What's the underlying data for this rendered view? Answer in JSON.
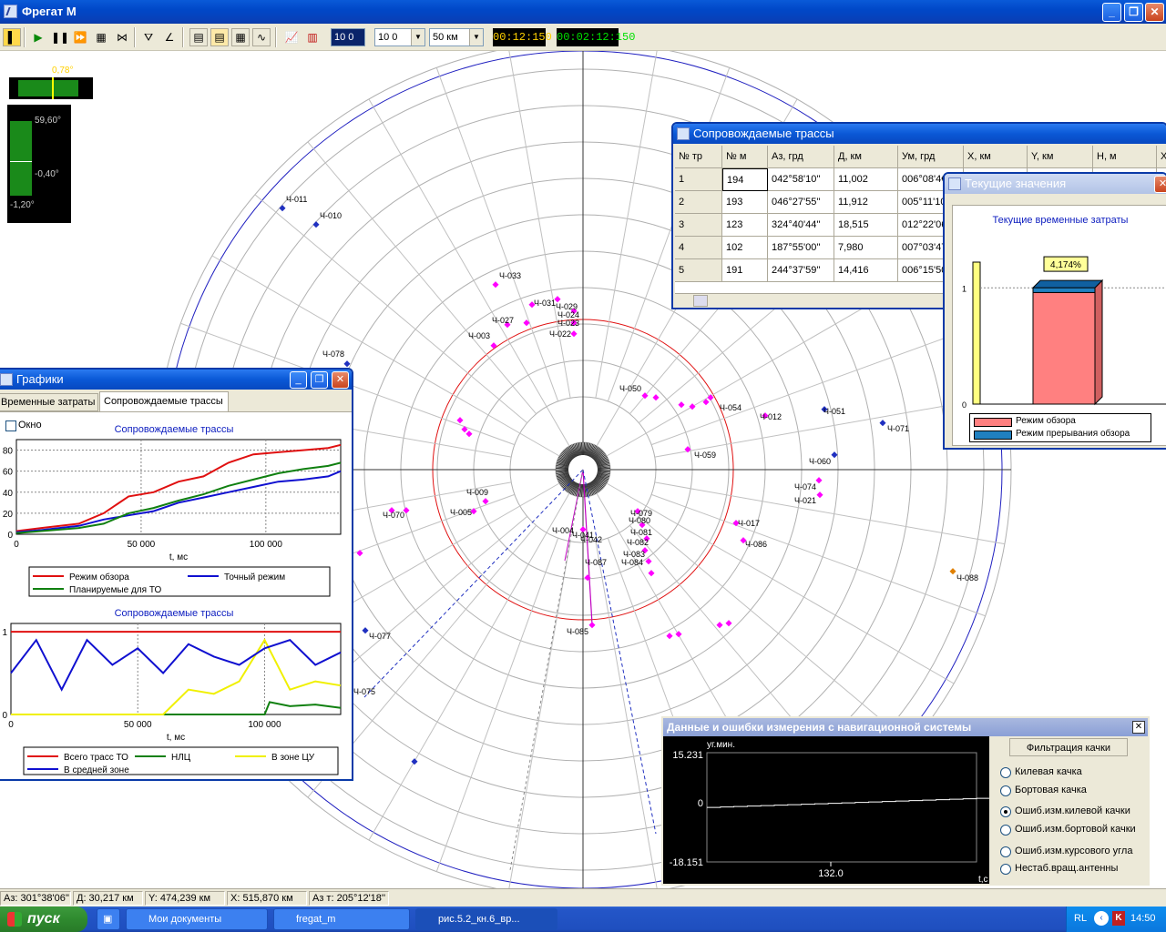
{
  "app": {
    "title": "Фрегат М"
  },
  "toolbar": {
    "field1": "10 0",
    "field2": "10 0",
    "range": "50 км",
    "time1": "00:12:150",
    "time2": "00:02:12:150"
  },
  "indicators": {
    "top_value": "0,78°",
    "top_level_fraction": 0.72,
    "v_top": "59,60°",
    "v_mid": "-0,40°",
    "v_bottom": "-1,20°"
  },
  "radar": {
    "targets": [
      "Ч-011",
      "Ч-010",
      "Ч-033",
      "Ч-031",
      "Ч-029",
      "Ч-024",
      "Ч-023",
      "Ч-022",
      "Ч-027",
      "Ч-003",
      "Ч-078",
      "Ч-059",
      "Ч-060",
      "Ч-071",
      "Ч-074",
      "Ч-021",
      "Ч-054",
      "Ч-012",
      "Ч-051",
      "Ч-009",
      "Ч-005",
      "Ч-070",
      "Ч-079",
      "Ч-080",
      "Ч-081",
      "Ч-082",
      "Ч-083",
      "Ч-084",
      "Ч-086",
      "Ч-087",
      "Ч-085",
      "Ч-088",
      "Ч-077",
      "Ч-075",
      "Ч-004",
      "Ч-042",
      "Ч-041",
      "Ч-017",
      "Ч-050"
    ]
  },
  "tracks_window": {
    "title": "Сопровождаемые трассы",
    "columns": [
      "№ тр",
      "№ м",
      "Аз, грд",
      "Д, км",
      "Ум, грд",
      "X, км",
      "Y, км",
      "H, м",
      "X"
    ],
    "rows": [
      [
        "1",
        "194",
        "042°58'10''",
        "11,002",
        "006°08'4€"
      ],
      [
        "2",
        "193",
        "046°27'55''",
        "11,912",
        "005°11'10"
      ],
      [
        "3",
        "123",
        "324°40'44''",
        "18,515",
        "012°22'06"
      ],
      [
        "4",
        "102",
        "187°55'00''",
        "7,980",
        "007°03'47"
      ],
      [
        "5",
        "191",
        "244°37'59''",
        "14,416",
        "006°15'50"
      ]
    ]
  },
  "current_window": {
    "title": "Текущие значения",
    "chart_title": "Текущие временные затраты",
    "bar_label": "4,174%",
    "legend": [
      "Режим обзора",
      "Режим прерывания обзора"
    ],
    "tick_1": "1",
    "tick_0": "0"
  },
  "graphs_window": {
    "title": "Графики",
    "tabs": [
      "Временные затраты",
      "Сопровождаемые трассы"
    ],
    "checkbox_label": "Окно"
  },
  "nav_window": {
    "title": "Данные и ошибки измерения с навигационной системы",
    "ylabel": "уг.мин.",
    "y_top": "15.231",
    "y_zero": "0",
    "y_bottom": "-18.151",
    "x_tick": "132.0",
    "x_unit": "t,c",
    "filter_button": "Фильтрация качки",
    "options": [
      "Килевая качка",
      "Бортовая качка",
      "Ошиб.изм.килевой качки",
      "Ошиб.изм.бортовой качки",
      "Ошиб.изм.курсового угла",
      "Нестаб.вращ.антенны"
    ],
    "selected_option": "Ошиб.изм.килевой качки"
  },
  "status": {
    "az": "Аз: 301°38'06''",
    "d": "Д: 30,217 км",
    "y": "Y: 474,239 км",
    "x": "X: 515,870 км",
    "azt": "Аз т: 205°12'18''"
  },
  "taskbar": {
    "start": "пуск",
    "items": [
      "Мои документы",
      "fregat_m",
      "рис.5.2_кн.6_вр..."
    ],
    "lang": "RL",
    "clock": "14:50"
  },
  "chart_data": [
    {
      "type": "line",
      "title": "Сопровождаемые трассы",
      "xlabel": "t, мс",
      "xlim": [
        0,
        130000
      ],
      "ylim": [
        0,
        90
      ],
      "x_ticks": [
        "0",
        "50 000",
        "100 000"
      ],
      "y_ticks": [
        "0",
        "20",
        "40",
        "60",
        "80"
      ],
      "series": [
        {
          "name": "Режим обзора",
          "color": "#e01010",
          "x": [
            0,
            10000,
            25000,
            35000,
            45000,
            55000,
            65000,
            75000,
            85000,
            95000,
            105000,
            115000,
            125000,
            130000
          ],
          "y": [
            3,
            6,
            10,
            20,
            36,
            40,
            50,
            55,
            68,
            76,
            78,
            80,
            82,
            85
          ]
        },
        {
          "name": "Точный режим",
          "color": "#1010d0",
          "x": [
            0,
            10000,
            25000,
            35000,
            45000,
            55000,
            65000,
            75000,
            85000,
            95000,
            105000,
            115000,
            125000,
            130000
          ],
          "y": [
            2,
            4,
            8,
            14,
            18,
            22,
            30,
            35,
            40,
            45,
            50,
            52,
            55,
            60
          ]
        },
        {
          "name": "Планируемые для ТО",
          "color": "#108010",
          "x": [
            0,
            10000,
            25000,
            35000,
            45000,
            55000,
            65000,
            75000,
            85000,
            95000,
            105000,
            115000,
            125000,
            130000
          ],
          "y": [
            1,
            3,
            6,
            10,
            20,
            25,
            32,
            38,
            46,
            52,
            58,
            62,
            65,
            68
          ]
        }
      ],
      "legend": "bottom"
    },
    {
      "type": "line",
      "title": "Сопровождаемые трассы",
      "xlabel": "t, мс",
      "xlim": [
        0,
        130000
      ],
      "ylim": [
        0,
        1.1
      ],
      "x_ticks": [
        "0",
        "50 000",
        "100 000"
      ],
      "y_ticks": [
        "0",
        "1"
      ],
      "series": [
        {
          "name": "Всего трасс ТО",
          "color": "#e01010",
          "x": [
            0,
            130000
          ],
          "y": [
            1,
            1
          ]
        },
        {
          "name": "НЛЦ",
          "color": "#108010",
          "x": [
            0,
            100000,
            102000,
            110000,
            120000,
            130000
          ],
          "y": [
            0,
            0,
            0.15,
            0.1,
            0.12,
            0.08
          ]
        },
        {
          "name": "В зоне ЦУ",
          "color": "#f0f000",
          "x": [
            0,
            60000,
            70000,
            80000,
            90000,
            100000,
            110000,
            120000,
            130000
          ],
          "y": [
            0,
            0,
            0.3,
            0.25,
            0.4,
            0.9,
            0.3,
            0.4,
            0.35
          ]
        },
        {
          "name": "В средней зоне",
          "color": "#1010d0",
          "x": [
            0,
            10000,
            20000,
            30000,
            40000,
            50000,
            60000,
            70000,
            80000,
            90000,
            100000,
            110000,
            120000,
            130000
          ],
          "y": [
            0.5,
            0.9,
            0.3,
            0.9,
            0.6,
            0.8,
            0.5,
            0.85,
            0.7,
            0.6,
            0.8,
            0.9,
            0.6,
            0.75
          ]
        }
      ],
      "legend": "bottom"
    },
    {
      "type": "bar",
      "title": "Текущие временные затраты",
      "categories": [
        ""
      ],
      "series": [
        {
          "name": "Режим обзора",
          "values": [
            0.96
          ]
        },
        {
          "name": "Режим прерывания обзора",
          "values": [
            0.04174
          ]
        }
      ],
      "ylim": [
        0,
        1.3
      ]
    },
    {
      "type": "line",
      "ylabel": "уг.мин.",
      "xlabel": "t,c",
      "ylim": [
        -18.151,
        15.231
      ],
      "x": [
        0,
        132
      ],
      "y": [
        -1.5,
        1.3
      ]
    }
  ],
  "colors": {
    "accent": "#0a3aa8",
    "radar_ring": "#e01010",
    "radar_outer": "#2020c0",
    "target": "#ff00ff"
  }
}
